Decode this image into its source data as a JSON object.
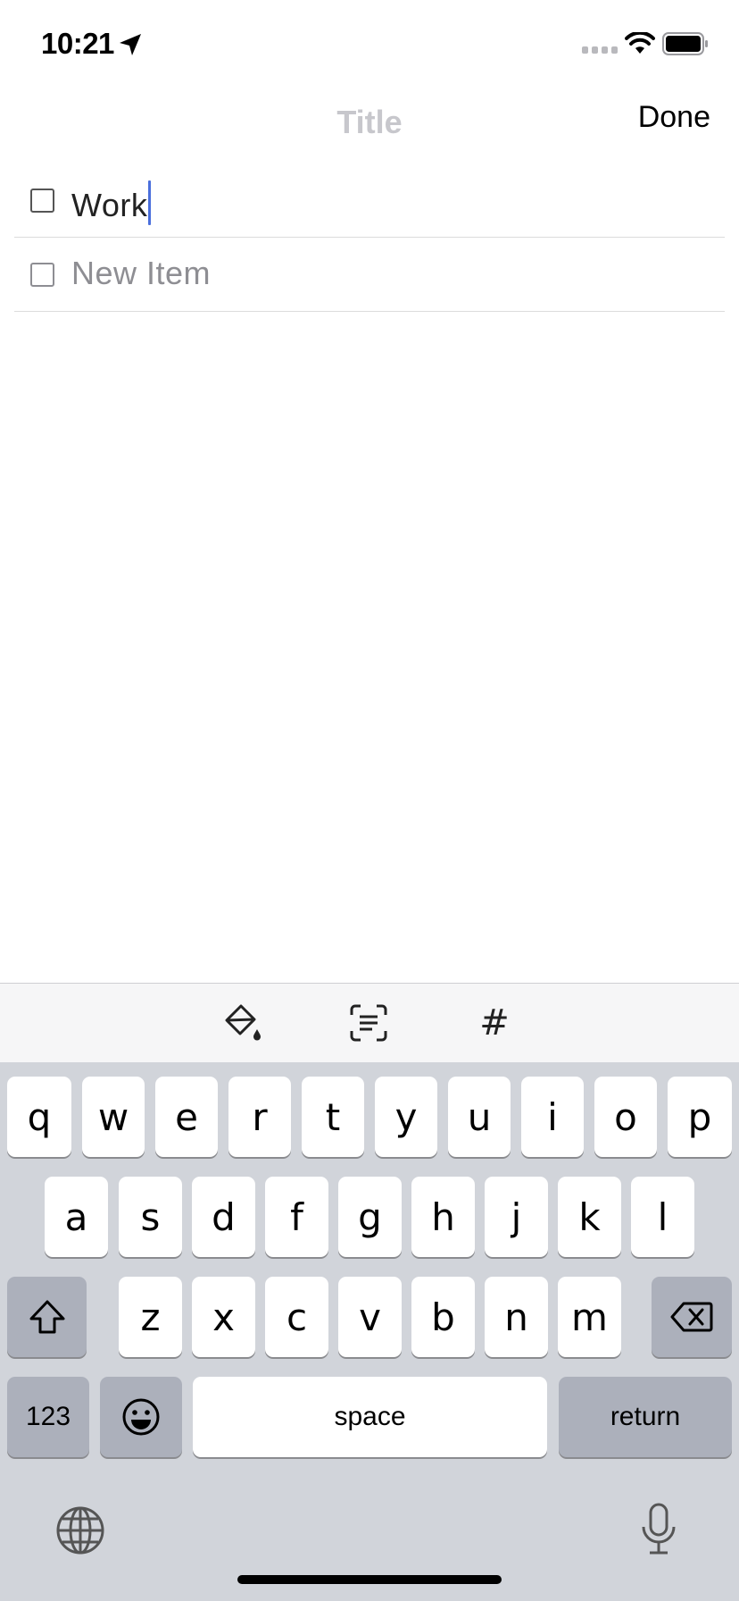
{
  "status": {
    "time": "10:21"
  },
  "nav": {
    "title_placeholder": "Title",
    "done_label": "Done"
  },
  "checklist": {
    "items": [
      {
        "text": "Work",
        "checked": false
      }
    ],
    "new_item_placeholder": "New Item"
  },
  "toolbar": {
    "tag_label": "#"
  },
  "keyboard": {
    "row1": [
      "q",
      "w",
      "e",
      "r",
      "t",
      "y",
      "u",
      "i",
      "o",
      "p"
    ],
    "row2": [
      "a",
      "s",
      "d",
      "f",
      "g",
      "h",
      "j",
      "k",
      "l"
    ],
    "row3": [
      "z",
      "x",
      "c",
      "v",
      "b",
      "n",
      "m"
    ],
    "numbers_label": "123",
    "space_label": "space",
    "return_label": "return"
  },
  "icons": {
    "location": "location-arrow-icon",
    "signal": "cellular-signal-icon",
    "wifi": "wifi-icon",
    "battery": "battery-icon",
    "background_color": "paint-bucket-icon",
    "scan_text": "scan-text-icon",
    "shift": "shift-arrow-icon",
    "delete": "backspace-icon",
    "emoji": "emoji-icon",
    "globe": "globe-icon",
    "mic": "microphone-icon"
  },
  "colors": {
    "caret": "#4a6fdc",
    "keyboard_bg": "#d1d4da",
    "placeholder": "#8e8e93"
  }
}
